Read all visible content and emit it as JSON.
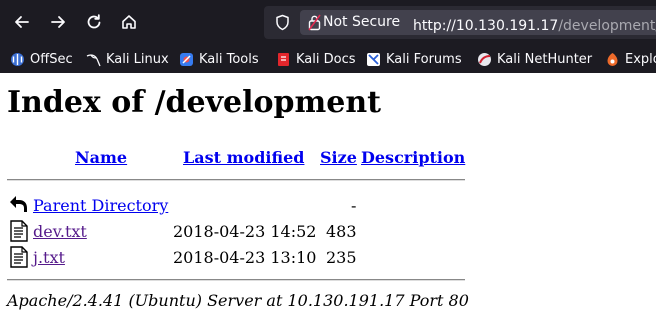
{
  "browser": {
    "security_label": "Not Secure",
    "url_host": "http://10.130.191.17",
    "url_path": "/development/",
    "bookmarks": [
      {
        "label": "OffSec",
        "icon": "offsec-icon"
      },
      {
        "label": "Kali Linux",
        "icon": "kali-dragon-icon"
      },
      {
        "label": "Kali Tools",
        "icon": "kali-tools-icon"
      },
      {
        "label": "Kali Docs",
        "icon": "kali-docs-icon"
      },
      {
        "label": "Kali Forums",
        "icon": "kali-forums-icon"
      },
      {
        "label": "Kali NetHunter",
        "icon": "nethunter-icon"
      },
      {
        "label": "Explo",
        "icon": "exploit-db-icon"
      }
    ],
    "colors": {
      "chrome": "#1c1b22",
      "urlbar": "#2b2a33"
    }
  },
  "page": {
    "title": "Index of /development",
    "columns": {
      "name": "Name",
      "last_modified": "Last modified",
      "size": "Size",
      "description": "Description"
    },
    "rows": [
      {
        "name": "Parent Directory",
        "modified": "",
        "size": "-",
        "description": "",
        "icon": "back-arrow-icon"
      },
      {
        "name": "dev.txt",
        "modified": "2018-04-23 14:52",
        "size": "483",
        "description": "",
        "icon": "text-file-icon"
      },
      {
        "name": "j.txt",
        "modified": "2018-04-23 13:10",
        "size": "235",
        "description": "",
        "icon": "text-file-icon"
      }
    ],
    "footer": "Apache/2.4.41 (Ubuntu) Server at 10.130.191.17 Port 80"
  }
}
